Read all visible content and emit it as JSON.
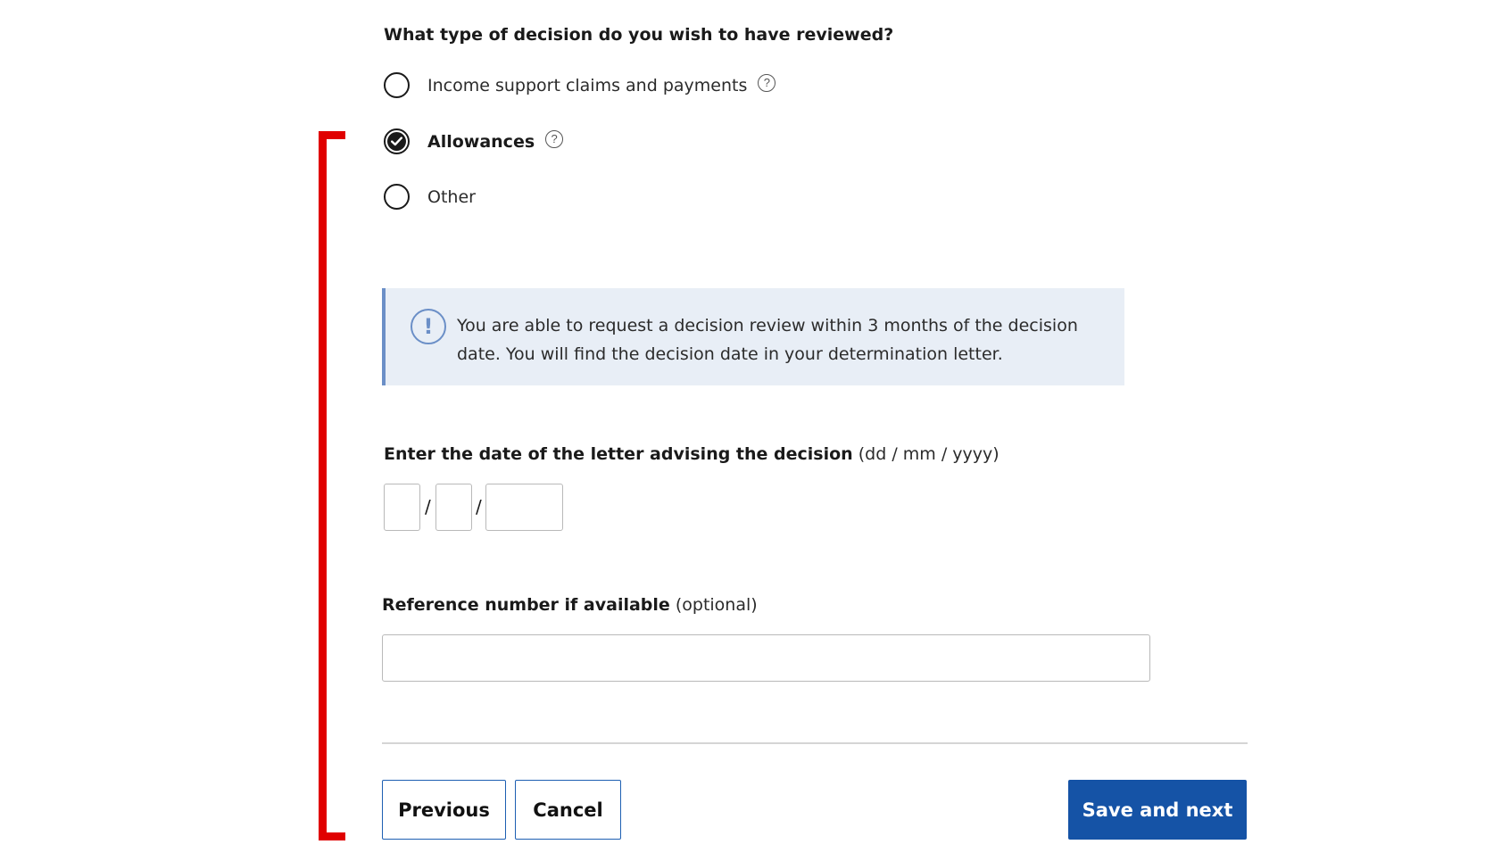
{
  "question": {
    "title": "What type of decision do you wish to have reviewed?",
    "options": [
      {
        "label": "Income support claims and payments",
        "selected": false,
        "has_help": true
      },
      {
        "label": "Allowances",
        "selected": true,
        "has_help": true
      },
      {
        "label": "Other",
        "selected": false,
        "has_help": false
      }
    ],
    "help_icon_glyph": "?"
  },
  "info_box": {
    "icon_glyph": "!",
    "text": "You are able to request a decision review within 3 months of the decision date. You will find the decision date in your determination letter."
  },
  "date_field": {
    "label": "Enter the date of the letter advising the decision",
    "hint": "(dd / mm / yyyy)",
    "separator": "/",
    "day_value": "",
    "month_value": "",
    "year_value": ""
  },
  "reference_field": {
    "label": "Reference number if available",
    "hint": "(optional)",
    "value": ""
  },
  "buttons": {
    "previous": "Previous",
    "cancel": "Cancel",
    "save_next": "Save and next"
  },
  "colors": {
    "annotation_bracket": "#e00000",
    "primary_button": "#1553a6",
    "info_accent": "#6b8fc7",
    "info_background": "#e8eef6"
  }
}
